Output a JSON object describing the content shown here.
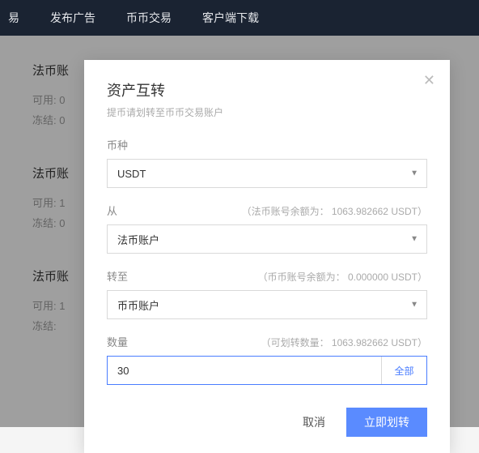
{
  "nav": {
    "items": [
      "易",
      "发布广告",
      "币币交易",
      "客户端下载"
    ]
  },
  "bg": {
    "blocks": [
      {
        "title": "法币账",
        "available_label": "可用:",
        "available_value": "0",
        "frozen_label": "冻结:",
        "frozen_value": "0"
      },
      {
        "title": "法币账",
        "available_label": "可用:",
        "available_value": "1",
        "frozen_label": "冻结:",
        "frozen_value": "0"
      },
      {
        "title": "法币账",
        "available_label": "可用:",
        "available_value": "1",
        "frozen_label": "冻结:",
        "frozen_value": ""
      }
    ]
  },
  "modal": {
    "title": "资产互转",
    "subtitle": "提币请划转至币币交易账户",
    "coin_label": "币种",
    "coin_value": "USDT",
    "from_label": "从",
    "from_hint": "（法币账号余额为： 1063.982662 USDT）",
    "from_value": "法币账户",
    "to_label": "转至",
    "to_hint": "（币币账号余额为： 0.000000 USDT）",
    "to_value": "币币账户",
    "amount_label": "数量",
    "amount_hint": "（可划转数量： 1063.982662 USDT）",
    "amount_value": "30",
    "all_label": "全部",
    "cancel": "取消",
    "submit": "立即划转"
  }
}
